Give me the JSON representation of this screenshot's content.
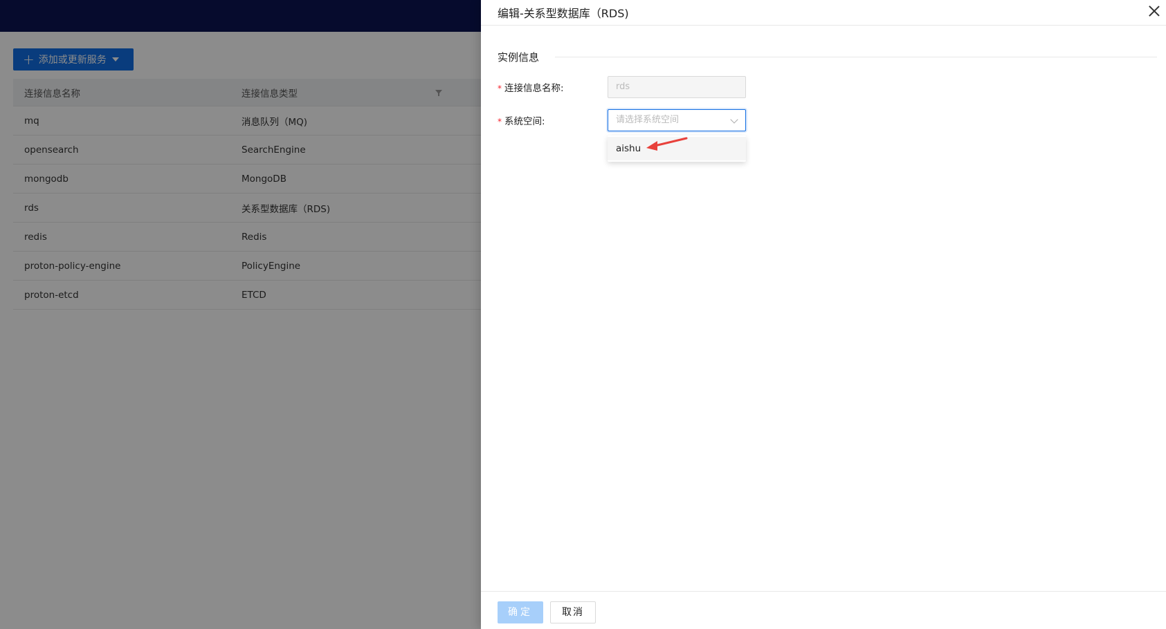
{
  "app": {
    "add_button_label": "添加或更新服务",
    "table": {
      "columns": [
        "连接信息名称",
        "连接信息类型"
      ],
      "rows": [
        {
          "name": "mq",
          "type": "消息队列（MQ)"
        },
        {
          "name": "opensearch",
          "type": "SearchEngine"
        },
        {
          "name": "mongodb",
          "type": "MongoDB"
        },
        {
          "name": "rds",
          "type": "关系型数据库（RDS)"
        },
        {
          "name": "redis",
          "type": "Redis"
        },
        {
          "name": "proton-policy-engine",
          "type": "PolicyEngine"
        },
        {
          "name": "proton-etcd",
          "type": "ETCD"
        }
      ]
    }
  },
  "drawer": {
    "title": "编辑-关系型数据库（RDS)",
    "section_title": "实例信息",
    "fields": {
      "name_label": "连接信息名称:",
      "name_value": "rds",
      "space_label": "系统空间:",
      "space_placeholder": "请选择系统空间"
    },
    "dropdown_options": [
      "aishu"
    ],
    "ok_label": "确定",
    "cancel_label": "取消"
  },
  "colors": {
    "topbar": "#0c1553",
    "primary": "#126ee3",
    "required": "#f5222d",
    "annotation_arrow": "#e8413b"
  }
}
